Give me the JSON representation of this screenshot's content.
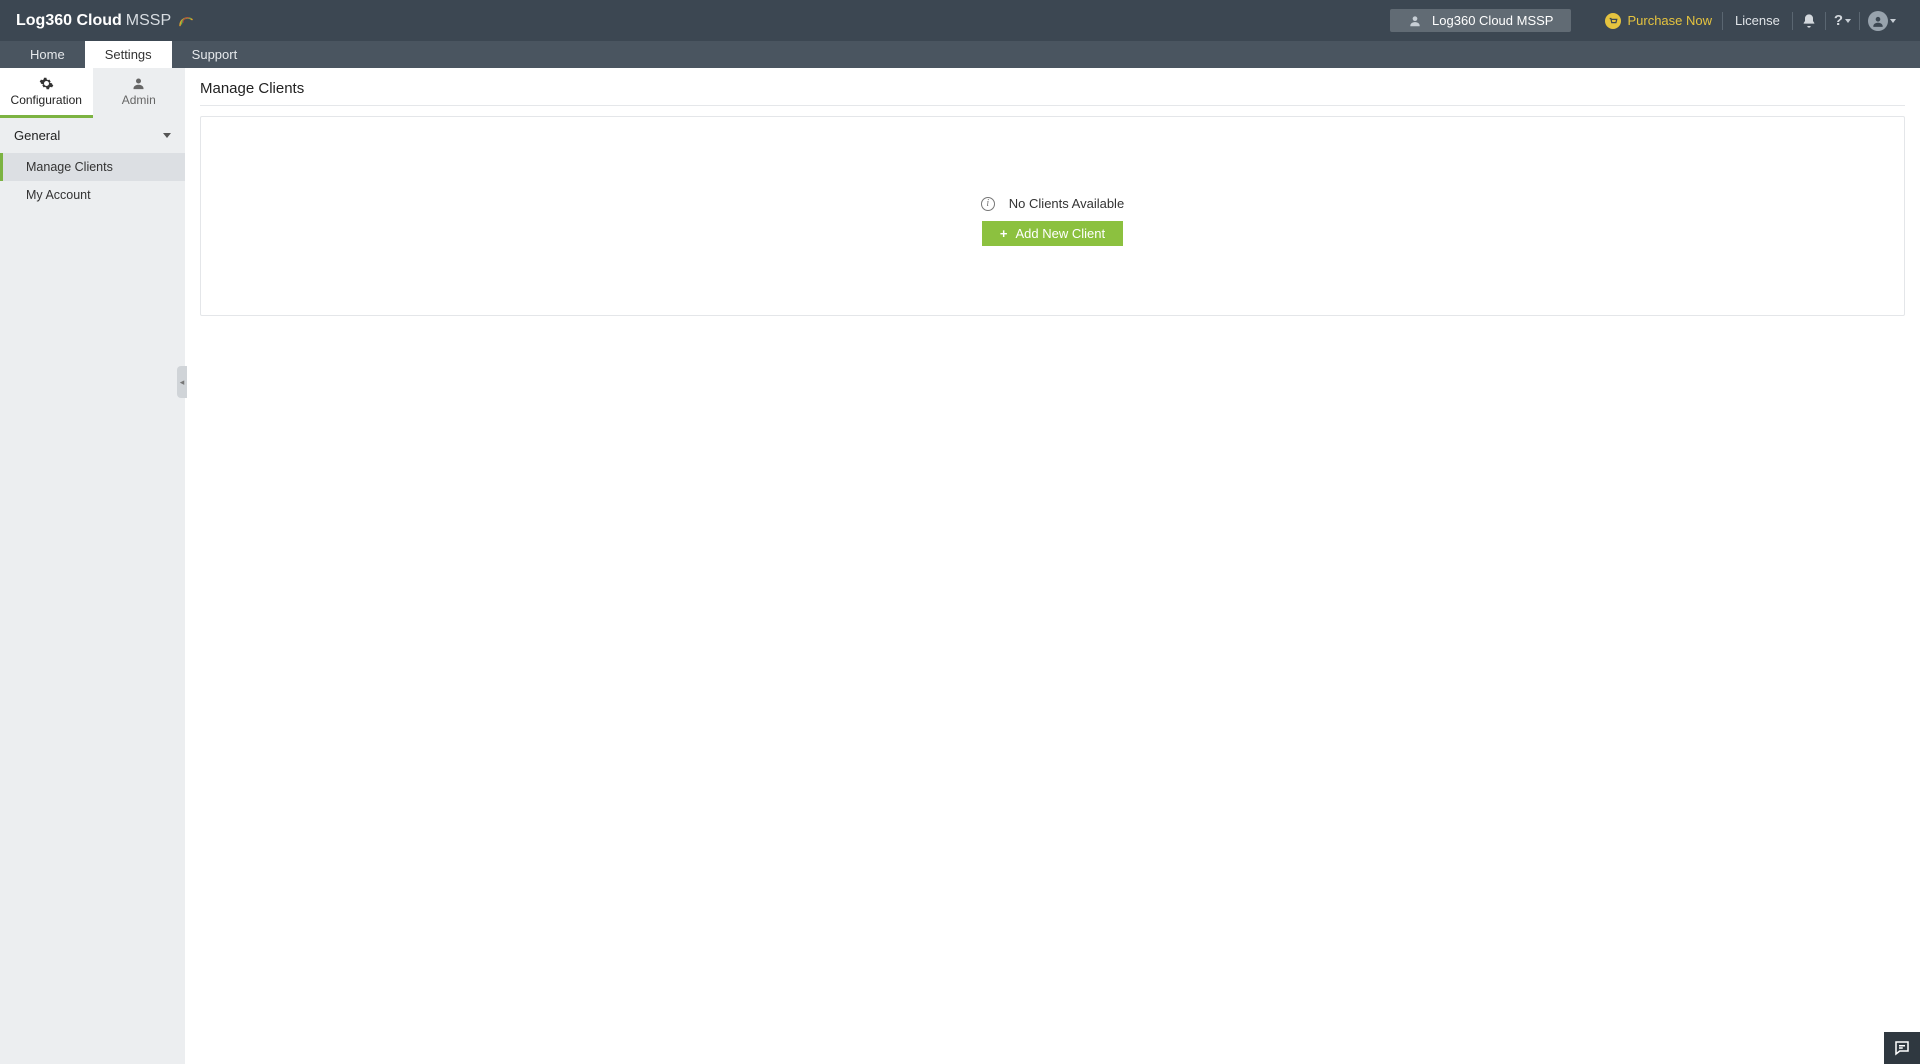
{
  "header": {
    "brand_main": "Log360 Cloud",
    "brand_sub": "MSSP",
    "tenant": "Log360 Cloud MSSP",
    "purchase_label": "Purchase Now",
    "license_label": "License",
    "help_symbol": "?"
  },
  "nav": {
    "tabs": [
      {
        "label": "Home"
      },
      {
        "label": "Settings"
      },
      {
        "label": "Support"
      }
    ]
  },
  "sidebar": {
    "subtabs": [
      {
        "label": "Configuration"
      },
      {
        "label": "Admin"
      }
    ],
    "section_header": "General",
    "items": [
      {
        "label": "Manage Clients"
      },
      {
        "label": "My Account"
      }
    ]
  },
  "main": {
    "title": "Manage Clients",
    "empty_message": "No Clients Available",
    "add_button": "Add New Client"
  }
}
